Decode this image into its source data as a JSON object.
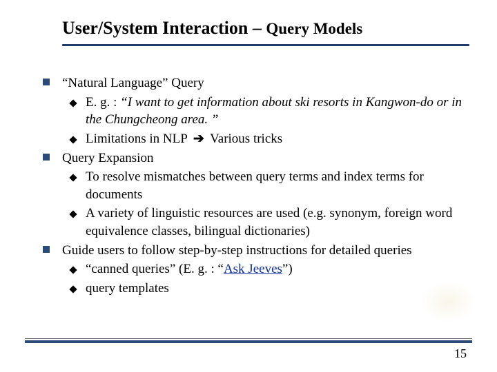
{
  "title": {
    "main": "User/System Interaction",
    "separator": " – ",
    "sub": "Query Models"
  },
  "bullets": [
    {
      "text": "“Natural Language” Query",
      "children": [
        {
          "prefix": "E. g. : ",
          "italic": "“I want to get information about ski resorts in Kangwon-do or in the Chungcheong area. ”"
        },
        {
          "before": "Limitations in NLP ",
          "arrow": "→",
          "after": " Various tricks"
        }
      ]
    },
    {
      "text": "Query Expansion",
      "children": [
        {
          "plain": "To resolve mismatches between query terms and index terms for documents"
        },
        {
          "plain": "A variety of linguistic resources are used (e.g. synonym, foreign word equivalence classes, bilingual dictionaries)"
        }
      ]
    },
    {
      "text": "Guide users to follow step-by-step instructions for detailed queries",
      "children": [
        {
          "before": "“canned queries” (E. g. : “",
          "link": "Ask Jeeves",
          "after": "”)"
        },
        {
          "plain": "query templates"
        }
      ]
    }
  ],
  "arrow_glyph": "➔",
  "page_number": "15"
}
